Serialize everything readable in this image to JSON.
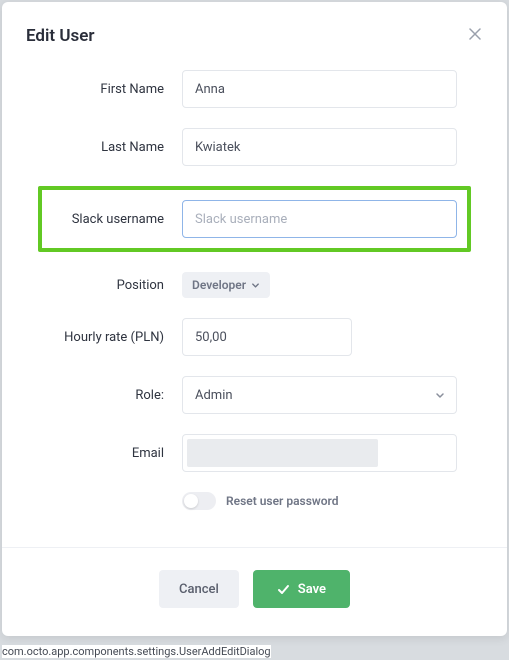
{
  "dialog": {
    "title": "Edit User"
  },
  "fields": {
    "first_name": {
      "label": "First Name",
      "value": "Anna"
    },
    "last_name": {
      "label": "Last Name",
      "value": "Kwiatek"
    },
    "slack_username": {
      "label": "Slack username",
      "value": "",
      "placeholder": "Slack username"
    },
    "position": {
      "label": "Position",
      "value": "Developer"
    },
    "hourly_rate": {
      "label": "Hourly rate (PLN)",
      "value": "50,00"
    },
    "role": {
      "label": "Role:",
      "value": "Admin"
    },
    "email": {
      "label": "Email"
    }
  },
  "toggle": {
    "label": "Reset user password"
  },
  "footer": {
    "cancel": "Cancel",
    "save": "Save"
  },
  "debug": "com.octo.app.components.settings.UserAddEditDialog"
}
